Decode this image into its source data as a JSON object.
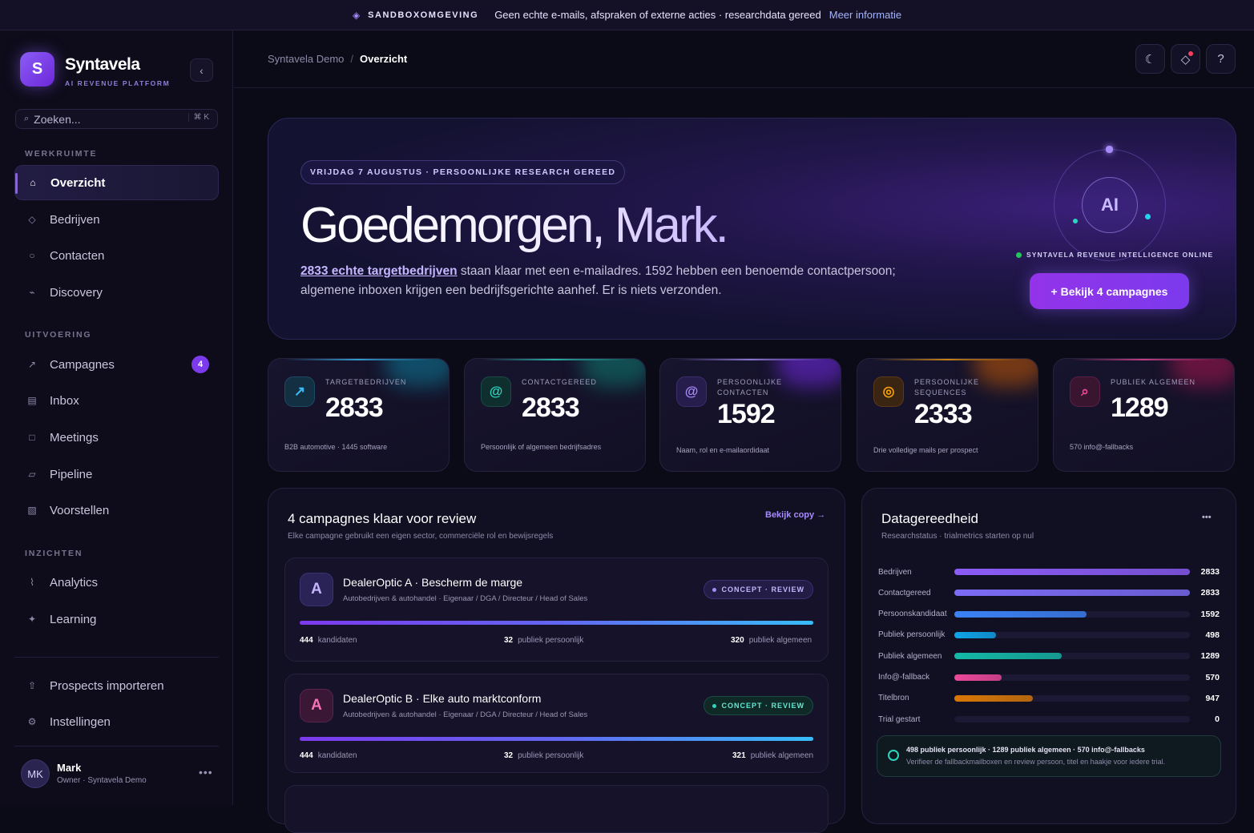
{
  "banner": {
    "tag": "SANDBOXOMGEVING",
    "message": "Geen echte e-mails, afspraken of externe acties · researchdata gereed",
    "link": "Meer informatie"
  },
  "sidebar": {
    "logo_letter": "S",
    "brand": "Syntavela",
    "brand_sub": "AI REVENUE PLATFORM",
    "search_placeholder": "Zoeken...",
    "search_shortcut": "⌘ K",
    "sections": {
      "workspace": "WERKRUIMTE",
      "execution": "UITVOERING",
      "insights": "INZICHTEN"
    },
    "items": {
      "overview": "Overzicht",
      "companies": "Bedrijven",
      "contacts": "Contacten",
      "discovery": "Discovery",
      "campaigns": "Campagnes",
      "campaigns_badge": "4",
      "inbox": "Inbox",
      "meetings": "Meetings",
      "pipeline": "Pipeline",
      "proposals": "Voorstellen",
      "analytics": "Analytics",
      "learning": "Learning",
      "import": "Prospects importeren",
      "settings": "Instellingen"
    },
    "user": {
      "initials": "MK",
      "name": "Mark",
      "role": "Owner · Syntavela Demo"
    }
  },
  "breadcrumb": {
    "root": "Syntavela Demo",
    "current": "Overzicht"
  },
  "hero": {
    "tag": "VRIJDAG 7 AUGUSTUS · PERSOONLIJKE RESEARCH GEREED",
    "greeting": "Goedemorgen, Mark.",
    "highlight": "2833 echte targetbedrijven",
    "text": " staan klaar met een e-mailadres. 1592 hebben een benoemde contactpersoon; algemene inboxen krijgen een bedrijfsgerichte aanhef. Er is niets verzonden.",
    "ai_label": "AI",
    "status": "SYNTAVELA REVENUE INTELLIGENCE ONLINE",
    "cta": "+ Bekijk 4 campagnes"
  },
  "stats": [
    {
      "icon": "↗",
      "label": "TARGETBEDRIJVEN",
      "value": "2833",
      "note": "B2B automotive · 1445 software",
      "color": "#38bdf8"
    },
    {
      "icon": "@",
      "label": "CONTACTGEREED",
      "value": "2833",
      "note": "Persoonlijk of algemeen bedrijfsadres",
      "color": "#2dd4bf"
    },
    {
      "icon": "@",
      "label": "PERSOONLIJKE CONTACTEN",
      "value": "1592",
      "note": "Naam, rol en e-mailaordidaat",
      "color": "#a78bfa"
    },
    {
      "icon": "◎",
      "label": "PERSOONLIJKE SEQUENCES",
      "value": "2333",
      "note": "Drie volledige mails per prospect",
      "color": "#f59e0b"
    },
    {
      "icon": "⌕",
      "label": "PUBLIEK ALGEMEEN",
      "value": "1289",
      "note": "570 info@-fallbacks",
      "color": "#ec4899"
    }
  ],
  "campaigns": {
    "title": "4 campagnes klaar voor review",
    "subtitle": "Elke campagne gebruikt een eigen sector, commerciële rol en bewijsregels",
    "link": "Bekijk copy →",
    "items": [
      {
        "letter": "A",
        "title": "DealerOptic A · Bescherm de marge",
        "subtitle": "Autobedrijven & autohandel · Eigenaar / DGA / Directeur / Head of Sales",
        "status": "CONCEPT · REVIEW",
        "candidates": "444",
        "candidates_label": "kandidaten",
        "personal": "32",
        "personal_label": "publiek persoonlijk",
        "general": "320",
        "general_label": "publiek algemeen",
        "progress": 1.0
      },
      {
        "letter": "A",
        "title": "DealerOptic B · Elke auto marktconform",
        "subtitle": "Autobedrijven & autohandel · Eigenaar / DGA / Directeur / Head of Sales",
        "status": "CONCEPT · REVIEW",
        "candidates": "444",
        "candidates_label": "kandidaten",
        "personal": "32",
        "personal_label": "publiek persoonlijk",
        "general": "321",
        "general_label": "publiek algemeen",
        "progress": 1.0
      }
    ]
  },
  "data_readiness": {
    "title": "Datagereedheid",
    "subtitle": "Researchstatus · trialmetrics starten op nul",
    "more": "•••",
    "max": 2833,
    "rows": [
      {
        "label": "Bedrijven",
        "value": 2833,
        "color": "#8b5cf6"
      },
      {
        "label": "Contactgereed",
        "value": 2833,
        "color": "#7c6cf6"
      },
      {
        "label": "Persoonskandidaat",
        "value": 1592,
        "color": "#3b82f6"
      },
      {
        "label": "Publiek persoonlijk",
        "value": 498,
        "color": "#0ea5e9"
      },
      {
        "label": "Publiek algemeen",
        "value": 1289,
        "color": "#14b8a6"
      },
      {
        "label": "Info@-fallback",
        "value": 570,
        "color": "#ec4899"
      },
      {
        "label": "Titelbron",
        "value": 947,
        "color": "#d97706"
      },
      {
        "label": "Trial gestart",
        "value": 0,
        "color": "#6366f1"
      }
    ],
    "note_title": "498 publiek persoonlijk · 1289 publiek algemeen · 570 info@-fallbacks",
    "note_text": "Verifieer de fallbackmailboxen en review persoon, titel en haakje voor iedere trial."
  }
}
